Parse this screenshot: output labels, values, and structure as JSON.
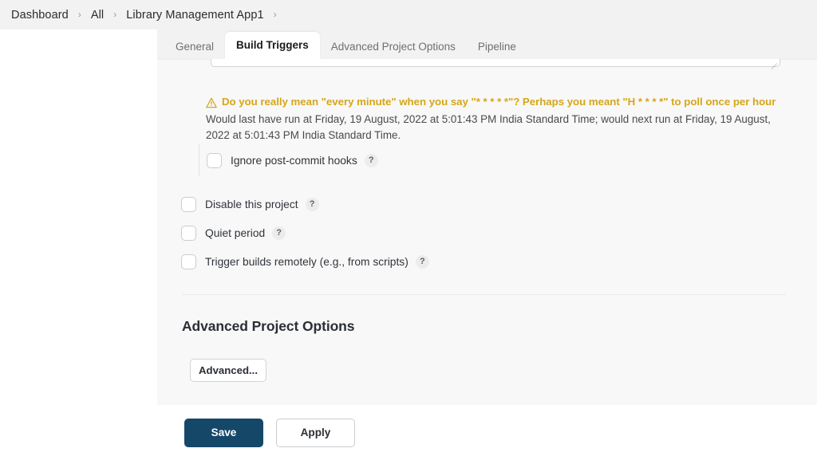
{
  "breadcrumb": {
    "items": [
      "Dashboard",
      "All",
      "Library Management App1"
    ],
    "separator": "›",
    "trailing_separator": "›"
  },
  "tabs": [
    {
      "label": "General",
      "active": false
    },
    {
      "label": "Build Triggers",
      "active": true
    },
    {
      "label": "Advanced Project Options",
      "active": false
    },
    {
      "label": "Pipeline",
      "active": false
    }
  ],
  "build_triggers": {
    "warning": {
      "icon": "warning-triangle-icon",
      "text": "Do you really mean \"every minute\" when you say \"* * * * *\"? Perhaps you meant \"H * * * *\" to poll once per hour",
      "color": "#d6a619"
    },
    "schedule_description": "Would last have run at Friday, 19 August, 2022 at 5:01:43 PM India Standard Time; would next run at Friday, 19 August, 2022 at 5:01:43 PM India Standard Time.",
    "nested_option": {
      "label": "Ignore post-commit hooks",
      "checked": false,
      "help": "?"
    },
    "options": [
      {
        "label": "Disable this project",
        "checked": false,
        "help": "?"
      },
      {
        "label": "Quiet period",
        "checked": false,
        "help": "?"
      },
      {
        "label": "Trigger builds remotely (e.g., from scripts)",
        "checked": false,
        "help": "?"
      }
    ]
  },
  "advanced_section": {
    "title": "Advanced Project Options",
    "button_label": "Advanced..."
  },
  "actions": {
    "save_label": "Save",
    "apply_label": "Apply",
    "save_color": "#154769"
  }
}
